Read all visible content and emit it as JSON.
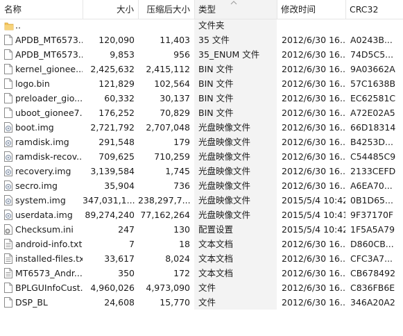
{
  "header": {
    "name": "名称",
    "size": "大小",
    "compressed_size": "压缩后大小",
    "type": "类型",
    "modified": "修改时间",
    "crc": "CRC32"
  },
  "rows": [
    {
      "icon": "folder-icon",
      "name": "..",
      "size": "",
      "csize": "",
      "type": "文件夹",
      "mtime": "",
      "crc": ""
    },
    {
      "icon": "file-icon",
      "name": "APDB_MT6573...",
      "size": "120,090",
      "csize": "11,403",
      "type": "35 文件",
      "mtime": "2012/6/30 16...",
      "crc": "A0243B..."
    },
    {
      "icon": "file-icon",
      "name": "APDB_MT6573...",
      "size": "9,853",
      "csize": "956",
      "type": "35_ENUM 文件",
      "mtime": "2012/6/30 16...",
      "crc": "74D5C5..."
    },
    {
      "icon": "file-icon",
      "name": "kernel_gionee...",
      "size": "2,425,632",
      "csize": "2,415,112",
      "type": "BIN 文件",
      "mtime": "2012/6/30 16...",
      "crc": "9A03662A"
    },
    {
      "icon": "file-icon",
      "name": "logo.bin",
      "size": "121,829",
      "csize": "102,564",
      "type": "BIN 文件",
      "mtime": "2012/6/30 16...",
      "crc": "57C1638B"
    },
    {
      "icon": "file-icon",
      "name": "preloader_gio...",
      "size": "60,332",
      "csize": "30,137",
      "type": "BIN 文件",
      "mtime": "2012/6/30 16...",
      "crc": "EC62581C"
    },
    {
      "icon": "file-icon",
      "name": "uboot_gionee7...",
      "size": "176,252",
      "csize": "70,829",
      "type": "BIN 文件",
      "mtime": "2012/6/30 16...",
      "crc": "A72E02A5"
    },
    {
      "icon": "disc-image-icon",
      "name": "boot.img",
      "size": "2,721,792",
      "csize": "2,707,048",
      "type": "光盘映像文件",
      "mtime": "2012/6/30 16...",
      "crc": "66D18314"
    },
    {
      "icon": "disc-image-icon",
      "name": "ramdisk.img",
      "size": "291,548",
      "csize": "179",
      "type": "光盘映像文件",
      "mtime": "2012/6/30 16...",
      "crc": "B4253D..."
    },
    {
      "icon": "disc-image-icon",
      "name": "ramdisk-recov...",
      "size": "709,625",
      "csize": "710,259",
      "type": "光盘映像文件",
      "mtime": "2012/6/30 16...",
      "crc": "C54485C9"
    },
    {
      "icon": "disc-image-icon",
      "name": "recovery.img",
      "size": "3,139,584",
      "csize": "1,745",
      "type": "光盘映像文件",
      "mtime": "2012/6/30 16...",
      "crc": "2133CEFD"
    },
    {
      "icon": "disc-image-icon",
      "name": "secro.img",
      "size": "35,904",
      "csize": "736",
      "type": "光盘映像文件",
      "mtime": "2012/6/30 16...",
      "crc": "A6EA70..."
    },
    {
      "icon": "disc-image-icon",
      "name": "system.img",
      "size": "347,031,1...",
      "csize": "238,297,7...",
      "type": "光盘映像文件",
      "mtime": "2015/5/4 10:42",
      "crc": "0B1D65..."
    },
    {
      "icon": "disc-image-icon",
      "name": "userdata.img",
      "size": "89,274,240",
      "csize": "77,162,264",
      "type": "光盘映像文件",
      "mtime": "2015/5/4 10:41",
      "crc": "9F37170F"
    },
    {
      "icon": "settings-file-icon",
      "name": "Checksum.ini",
      "size": "247",
      "csize": "130",
      "type": "配置设置",
      "mtime": "2015/5/4 10:42",
      "crc": "1F5A5A79"
    },
    {
      "icon": "text-file-icon",
      "name": "android-info.txt",
      "size": "7",
      "csize": "18",
      "type": "文本文档",
      "mtime": "2012/6/30 16...",
      "crc": "D860CB..."
    },
    {
      "icon": "text-file-icon",
      "name": "installed-files.txt",
      "size": "33,617",
      "csize": "8,024",
      "type": "文本文档",
      "mtime": "2012/6/30 16...",
      "crc": "CFC3A7..."
    },
    {
      "icon": "text-file-icon",
      "name": "MT6573_Andr...",
      "size": "350",
      "csize": "172",
      "type": "文本文档",
      "mtime": "2012/6/30 16...",
      "crc": "CB678492"
    },
    {
      "icon": "file-icon",
      "name": "BPLGUInfoCust...",
      "size": "4,960,026",
      "csize": "4,973,090",
      "type": "文件",
      "mtime": "2012/6/30 16...",
      "crc": "C836FB6E"
    },
    {
      "icon": "file-icon",
      "name": "DSP_BL",
      "size": "24,608",
      "csize": "15,770",
      "type": "文件",
      "mtime": "2012/6/30 16...",
      "crc": "346A20A2"
    }
  ]
}
